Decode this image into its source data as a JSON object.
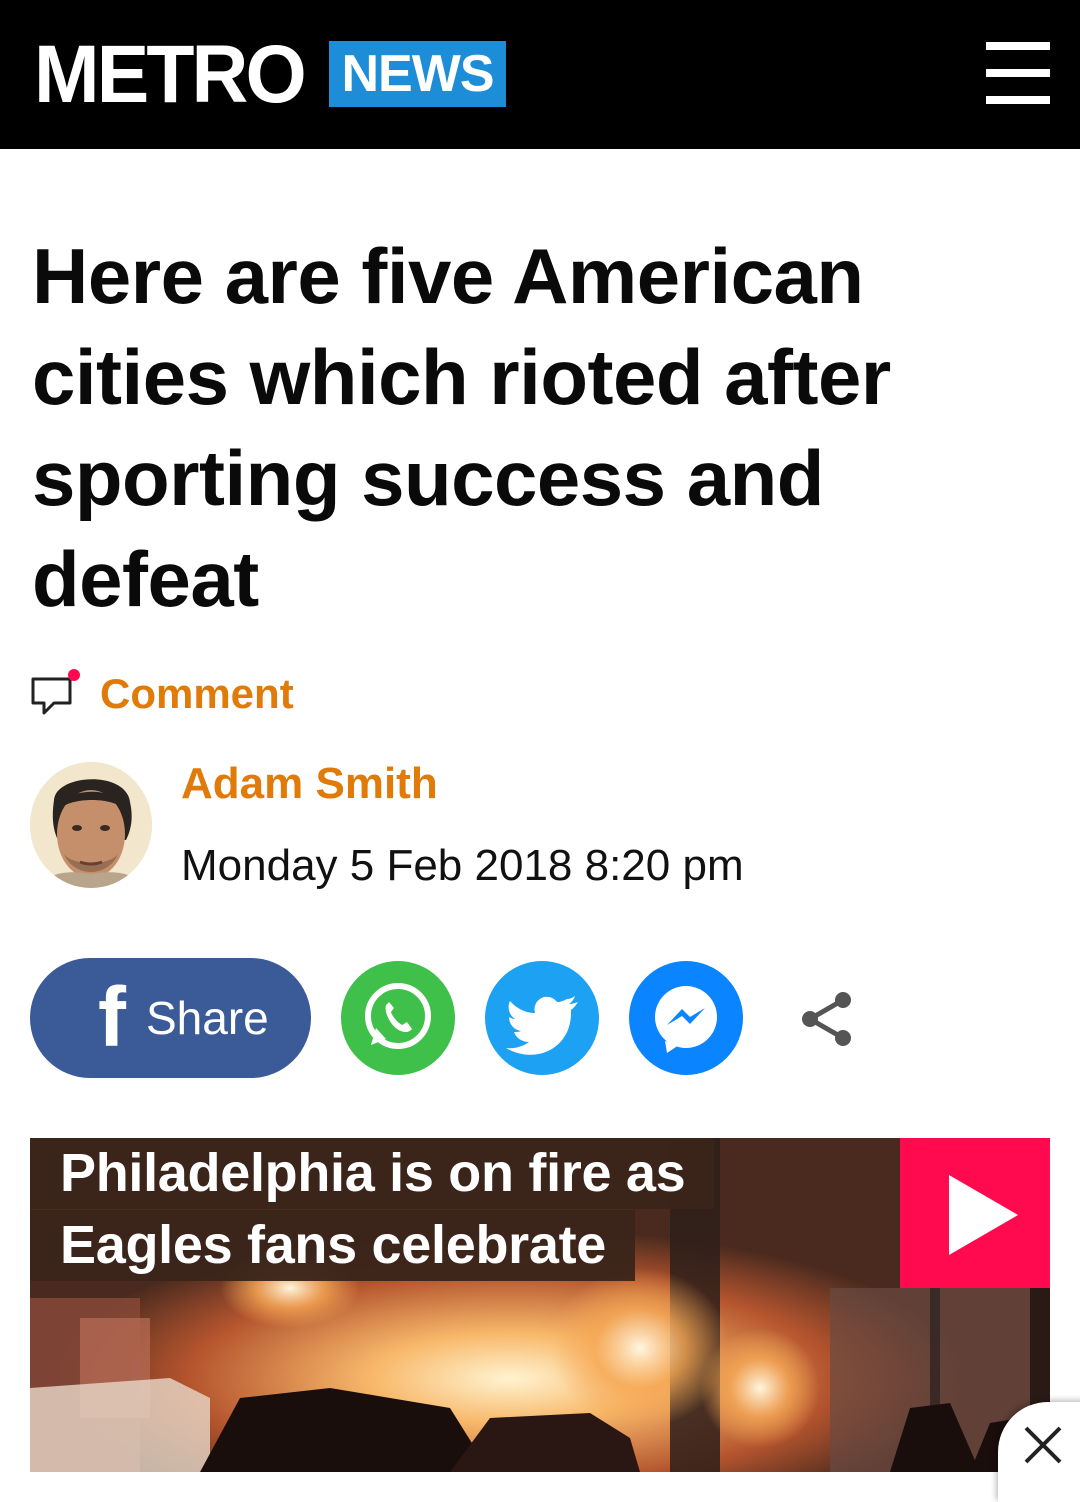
{
  "header": {
    "logo_text": "METRO",
    "section_badge": "NEWS",
    "badge_color": "#1d8dd8",
    "menu_icon": "hamburger-menu-icon"
  },
  "article": {
    "headline": "Here are five American cities which rioted after sporting success and defeat",
    "comment_label": "Comment",
    "comment_icon": "speech-bubble-icon",
    "accent_color": "#e07b0a",
    "author_name": "Adam Smith",
    "published": "Monday 5 Feb 2018 8:20 pm"
  },
  "share": {
    "facebook_label": "Share",
    "facebook_color": "#3b5a98",
    "whatsapp_color": "#3fc04a",
    "twitter_color": "#1da1f2",
    "messenger_color": "#0a84ff",
    "icons": [
      "facebook-icon",
      "whatsapp-icon",
      "twitter-icon",
      "messenger-icon",
      "share-icon"
    ]
  },
  "video": {
    "caption_line1": "Philadelphia is on fire as",
    "caption_line2": "Eagles fans celebrate",
    "play_color": "#ff0a4f"
  },
  "ad": {
    "close_icon": "close-icon"
  }
}
